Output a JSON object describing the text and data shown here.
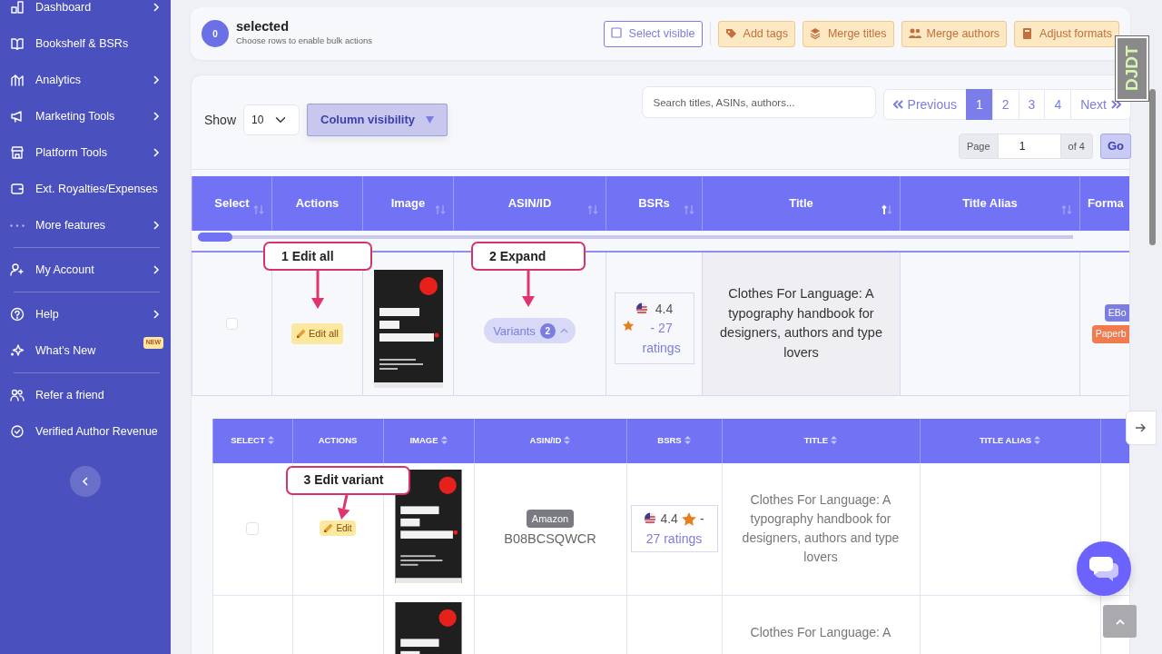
{
  "sidebar": {
    "groups": [
      [
        {
          "label": "Dashboard",
          "submenu": true
        },
        {
          "label": "Bookshelf & BSRs",
          "submenu": false
        },
        {
          "label": "Analytics",
          "submenu": true
        },
        {
          "label": "Marketing Tools",
          "submenu": true
        },
        {
          "label": "Platform Tools",
          "submenu": true
        },
        {
          "label": "Ext. Royalties/Expenses",
          "submenu": false
        },
        {
          "label": "More features",
          "submenu": true
        }
      ],
      [
        {
          "label": "My Account",
          "submenu": true
        }
      ],
      [
        {
          "label": "Help",
          "submenu": true
        },
        {
          "label": "What's New",
          "submenu": false,
          "badge": "NEW"
        }
      ],
      [
        {
          "label": "Refer a friend",
          "submenu": false
        },
        {
          "label": "Verified Author Revenue",
          "submenu": false
        }
      ]
    ]
  },
  "bulk_bar": {
    "count": "0",
    "title": "selected",
    "subtitle": "Choose rows to enable bulk actions",
    "buttons": [
      {
        "label": "Select visible",
        "kind": "outline"
      },
      {
        "label": "Add tags",
        "kind": "warning"
      },
      {
        "label": "Merge titles",
        "kind": "warning"
      },
      {
        "label": "Merge authors",
        "kind": "warning"
      },
      {
        "label": "Adjust formats",
        "kind": "warning"
      }
    ]
  },
  "controls": {
    "show_label": "Show",
    "page_length": "10",
    "column_visibility": "Column visibility",
    "search_placeholder": "Search titles, ASINs, authors...",
    "pagination": [
      {
        "label": "Previous",
        "kind": "prev",
        "selected": false
      },
      {
        "label": "1",
        "kind": "page",
        "selected": true
      },
      {
        "label": "2",
        "kind": "page",
        "selected": false
      },
      {
        "label": "3",
        "kind": "page",
        "selected": false
      },
      {
        "label": "4",
        "kind": "page",
        "selected": false
      },
      {
        "label": "Next",
        "kind": "next",
        "selected": false
      }
    ],
    "page_jump": {
      "label": "Page",
      "value": "1",
      "total": "of 4",
      "button": "Go"
    }
  },
  "table": {
    "columns": [
      {
        "label": "Select",
        "sortable": true,
        "sorted": false
      },
      {
        "label": "Actions",
        "sortable": false
      },
      {
        "label": "Image",
        "sortable": true,
        "sorted": false
      },
      {
        "label": "ASIN/ID",
        "sortable": true,
        "sorted": false
      },
      {
        "label": "BSRs",
        "sortable": true,
        "sorted": false
      },
      {
        "label": "Title",
        "sortable": true,
        "sorted": true
      },
      {
        "label": "Title Alias",
        "sortable": true,
        "sorted": false
      },
      {
        "label": "Forma",
        "sortable": false
      }
    ],
    "rows": [
      {
        "checked": false,
        "edit": "Edit all",
        "variants": {
          "label": "Variants",
          "count": "2",
          "expanded": true
        },
        "bsr": {
          "rating": "4.4",
          "link": "- 27 ratings"
        },
        "title": "Clothes For Language: A typography handbook for designers, authors and type lovers",
        "formats": [
          {
            "label": "EBo",
            "color": "#7b7de0"
          },
          {
            "label": "Paperb",
            "color": "#f07b4f"
          }
        ]
      }
    ]
  },
  "variants_table": {
    "columns": [
      {
        "label": "SELECT",
        "sortable": true
      },
      {
        "label": "ACTIONS",
        "sortable": false
      },
      {
        "label": "IMAGE",
        "sortable": true
      },
      {
        "label": "ASIN/ID",
        "sortable": true
      },
      {
        "label": "BSRS",
        "sortable": true
      },
      {
        "label": "TITLE",
        "sortable": true
      },
      {
        "label": "TITLE ALIAS",
        "sortable": true
      }
    ],
    "rows": [
      {
        "checked": false,
        "edit": "Edit",
        "platform": "Amazon",
        "asin": "B08BCSQWCR",
        "bsr": {
          "rating": "4.4",
          "separator": "-",
          "link": "27 ratings"
        },
        "title": "Clothes For Language: A typography handbook for designers, authors and type lovers"
      },
      {
        "title": "Clothes For Language: A"
      }
    ]
  },
  "annotations": [
    {
      "label": "1 Edit all"
    },
    {
      "label": "2 Expand"
    },
    {
      "label": "3 Edit variant"
    }
  ],
  "debug_toolbar": "DJDT"
}
